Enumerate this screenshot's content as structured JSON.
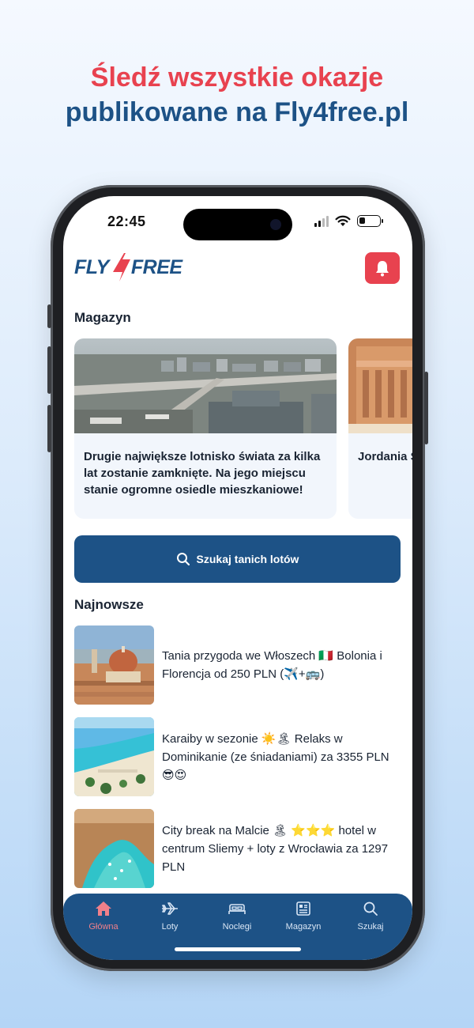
{
  "promo": {
    "line1": "Śledź wszystkie okazje",
    "line2": "publikowane na Fly4free.pl"
  },
  "status_bar": {
    "time": "22:45",
    "battery_level": 0.3
  },
  "header": {
    "logo_text": "FLY FREE",
    "logo_left": "FLY",
    "logo_right": "FREE",
    "notification_icon": "bell-icon"
  },
  "magazine": {
    "title": "Magazyn",
    "cards": [
      {
        "text": "Drugie największe lotnisko świata za kilka lat zostanie zamknięte. Na jego miejscu stanie ogromne osiedle mieszkaniowe!"
      },
      {
        "text": "Jordania Słynne sk błyskawic"
      }
    ]
  },
  "search_button": {
    "label": "Szukaj tanich lotów",
    "icon": "search-icon"
  },
  "latest": {
    "title": "Najnowsze",
    "items": [
      {
        "text": "Tania przygoda we Włoszech 🇮🇹 Bolonia i Florencja od 250 PLN (✈️+🚌)"
      },
      {
        "text": "Karaiby w sezonie ☀️🏝 Relaks w Dominikanie (ze śniadaniami) za 3355 PLN 😎😍"
      },
      {
        "text": "City break na Malcie 🏝 ⭐⭐⭐ hotel w centrum Sliemy + loty z Wrocławia za 1297 PLN"
      }
    ]
  },
  "bottom_nav": {
    "items": [
      {
        "label": "Główna",
        "icon": "home-icon",
        "active": true
      },
      {
        "label": "Loty",
        "icon": "plane-icon"
      },
      {
        "label": "Noclegi",
        "icon": "bed-icon"
      },
      {
        "label": "Magazyn",
        "icon": "newspaper-icon"
      },
      {
        "label": "Szukaj",
        "icon": "search-icon"
      }
    ]
  },
  "colors": {
    "brand_blue": "#1d5286",
    "brand_red": "#e8424f"
  }
}
